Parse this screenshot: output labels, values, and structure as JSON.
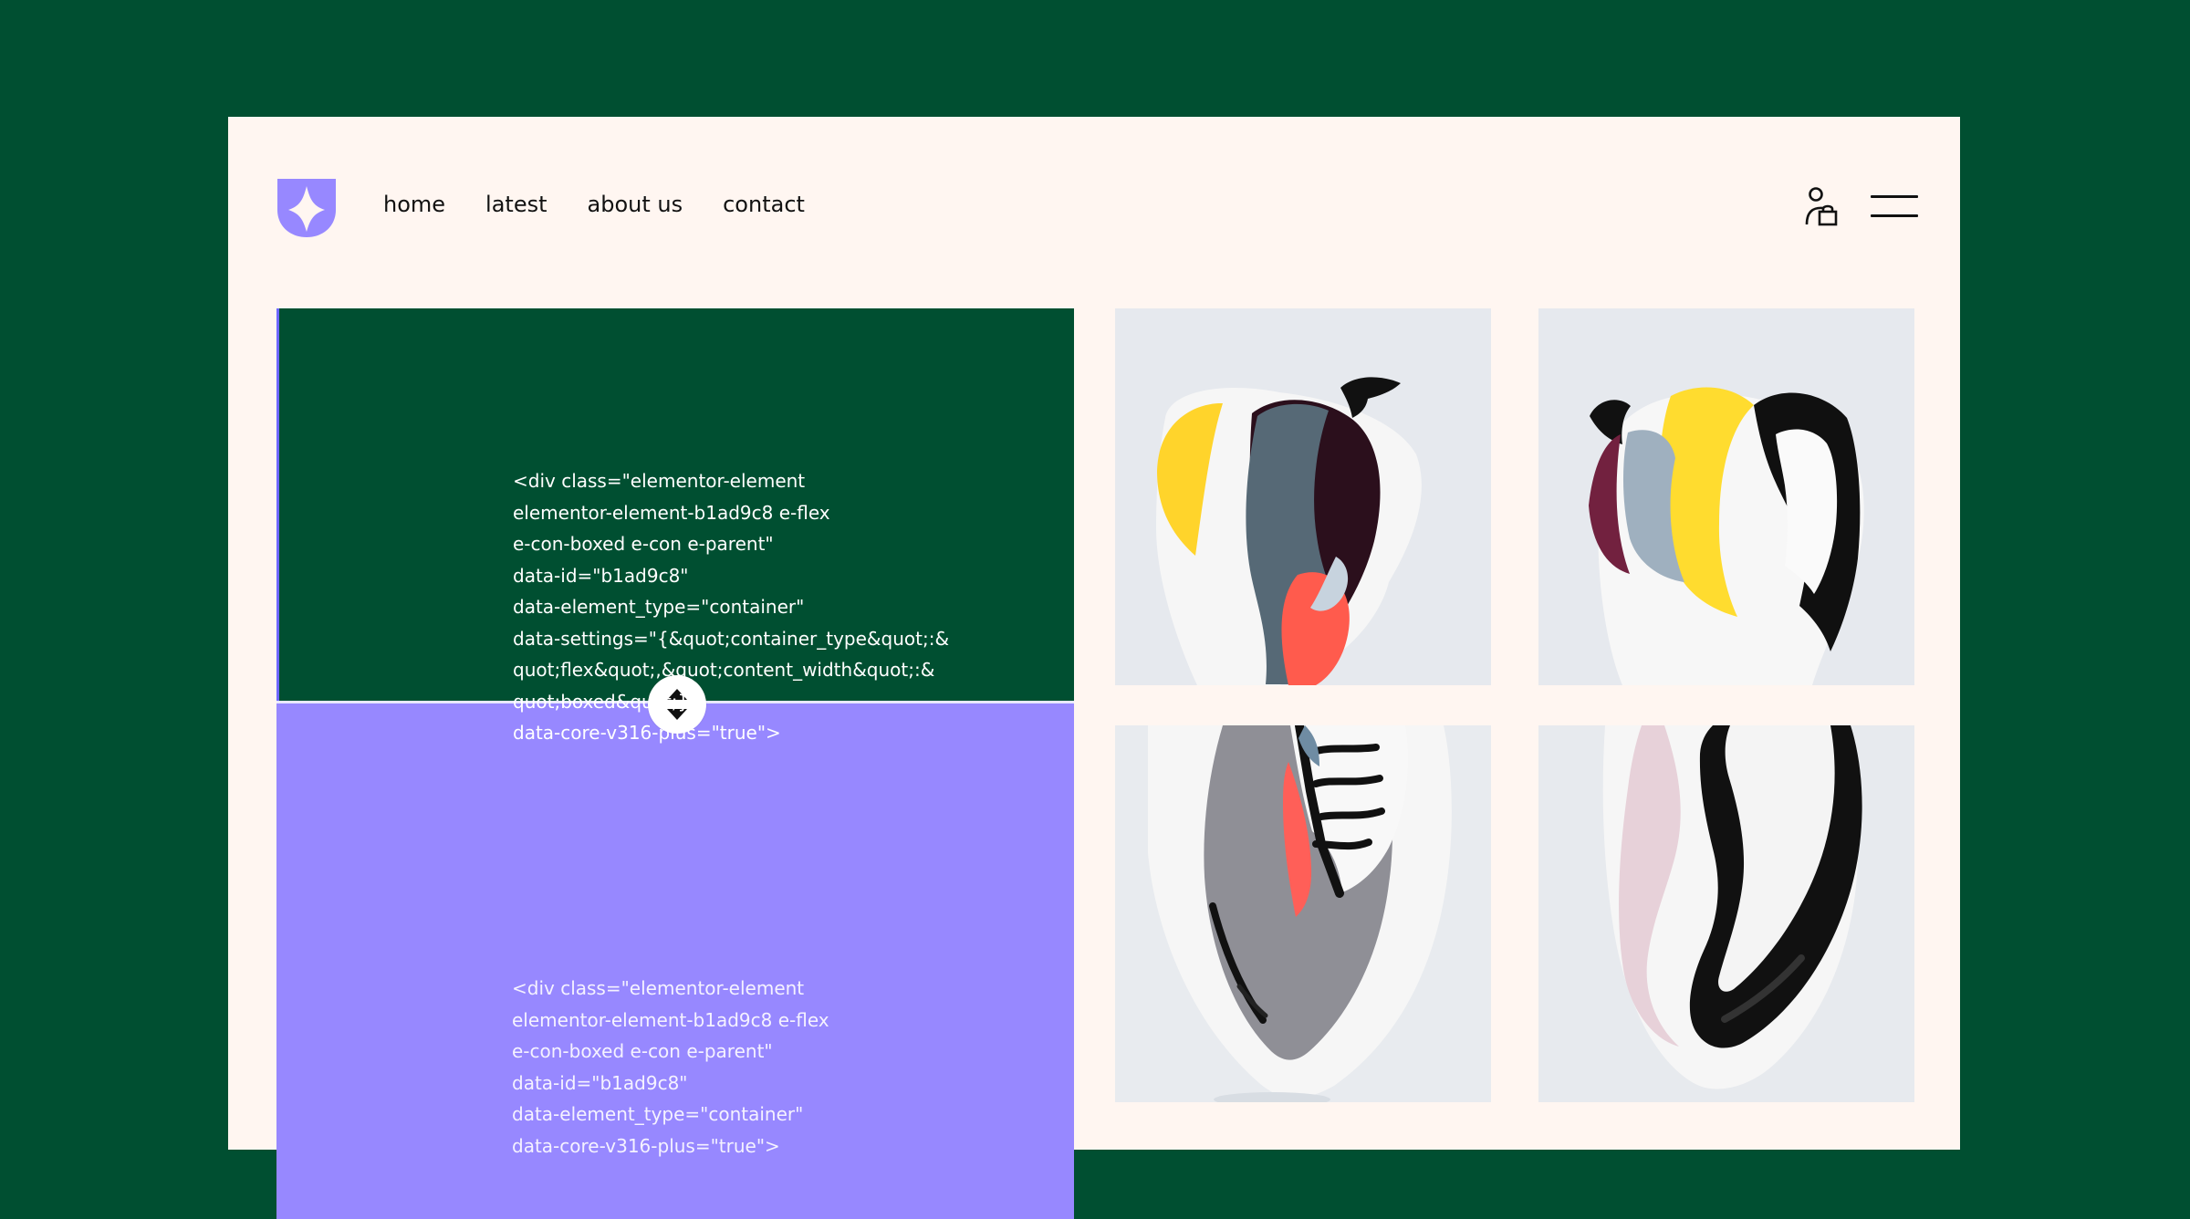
{
  "brand": {
    "logo_icon": "star-sparkle-logo-icon",
    "accent": "#9788ff",
    "background": "#004f31",
    "frame_background": "#fff6f1"
  },
  "nav": {
    "items": [
      {
        "label": "home"
      },
      {
        "label": "latest"
      },
      {
        "label": "about us"
      },
      {
        "label": "contact"
      }
    ]
  },
  "header_actions": {
    "account_icon": "user-lock-icon",
    "menu_icon": "hamburger-menu-icon"
  },
  "compare": {
    "top_lines": [
      "<div class=\"elementor-element",
      "elementor-element-b1ad9c8 e-flex",
      "e-con-boxed e-con e-parent\"",
      "data-id=\"b1ad9c8\"",
      "data-element_type=\"container\"",
      "data-settings=\"{&quot;container_type&quot;:&",
      "quot;flex&quot;,&quot;content_width&quot;:&",
      "quot;boxed&quot;}\"",
      "data-core-v316-plus=\"true\">"
    ],
    "bottom_lines": [
      "<div class=\"elementor-element",
      "elementor-element-b1ad9c8 e-flex",
      "e-con-boxed e-con e-parent\"",
      "data-id=\"b1ad9c8\"",
      "data-element_type=\"container\"",
      "data-core-v316-plus=\"true\">"
    ],
    "handle_icon": "up-down-arrows-icon"
  },
  "gallery": {
    "images": [
      {
        "name": "sneaker-side-image"
      },
      {
        "name": "sneaker-heel-image"
      },
      {
        "name": "sneaker-top-image"
      },
      {
        "name": "sneaker-sole-image"
      }
    ]
  }
}
